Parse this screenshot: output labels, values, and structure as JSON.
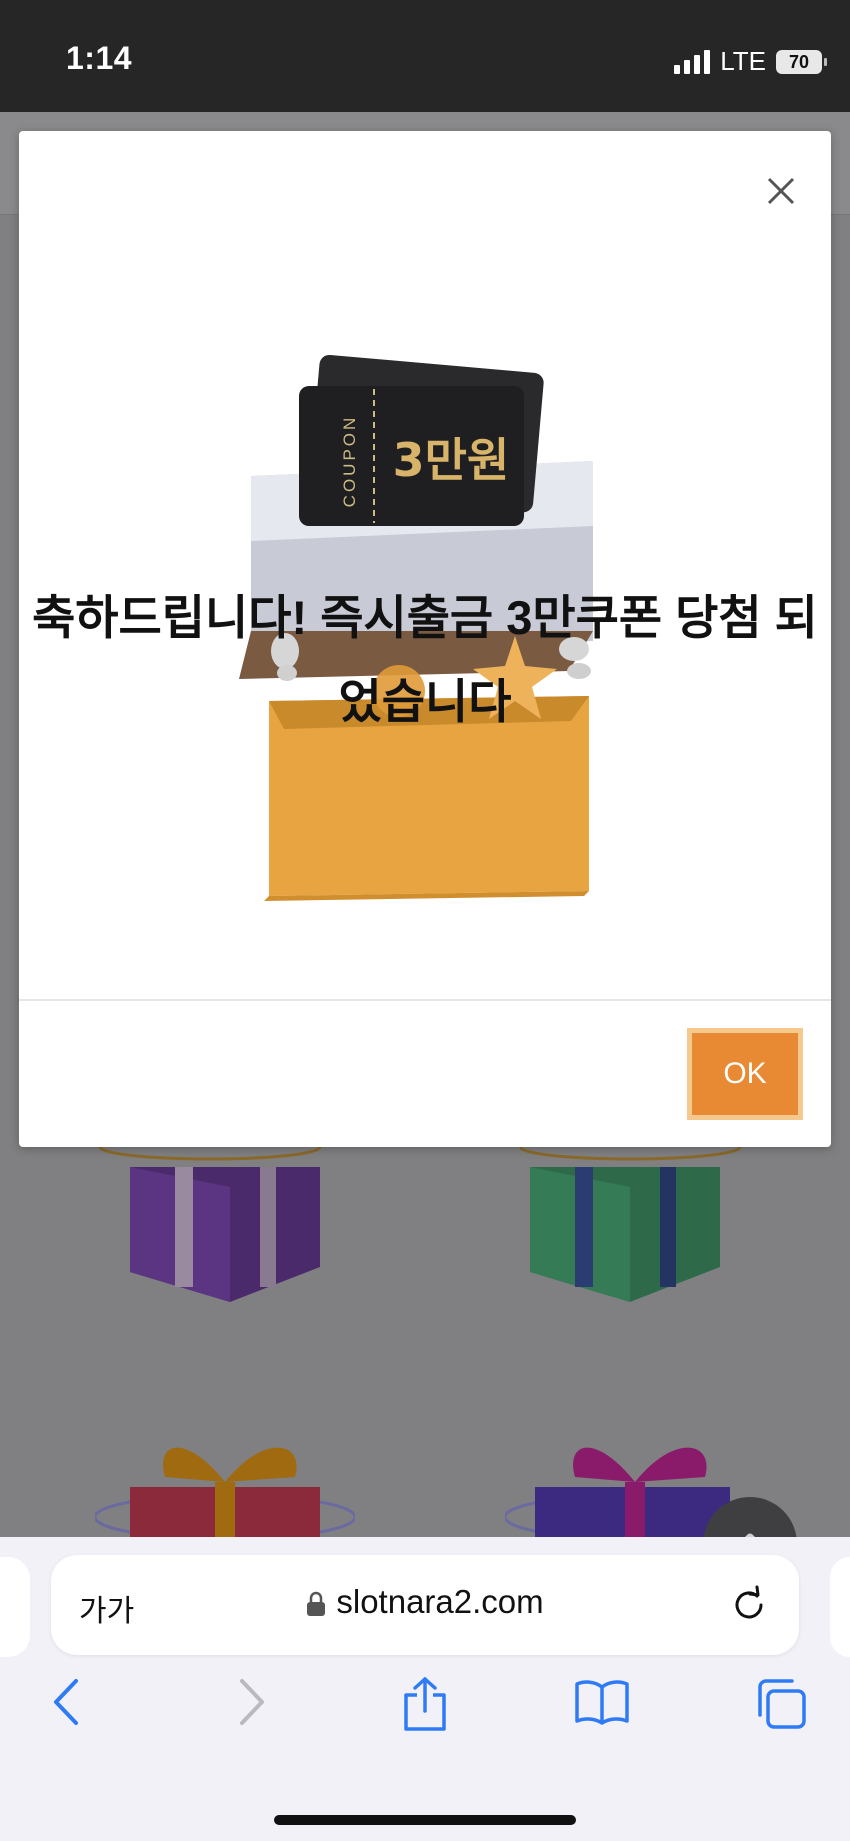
{
  "status_bar": {
    "time": "1:14",
    "network": "LTE",
    "battery": "70"
  },
  "modal": {
    "coupon_side_label": "COUPON",
    "coupon_amount": "3만원",
    "message_line1": "축하드립니다! 즉시출금 3만쿠폰 당첨 되",
    "message_line2": "었습니다",
    "ok_label": "OK"
  },
  "browser": {
    "text_size_label": "가가",
    "url": "slotnara2.com"
  },
  "icons": [
    "close-icon",
    "signal-icon",
    "battery-icon",
    "chevron-up-icon",
    "lock-icon",
    "reload-icon",
    "back-icon",
    "forward-icon",
    "share-icon",
    "bookmarks-icon",
    "tabs-icon"
  ]
}
